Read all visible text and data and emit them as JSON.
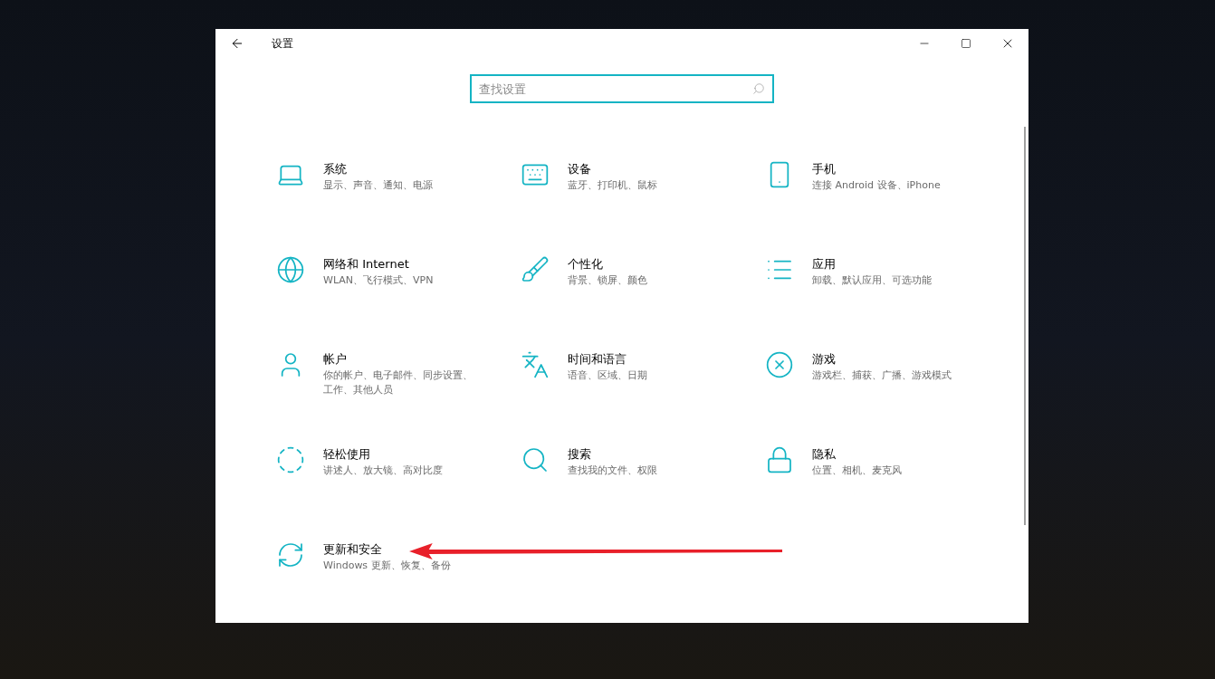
{
  "window": {
    "title": "设置"
  },
  "search": {
    "placeholder": "查找设置"
  },
  "categories": [
    {
      "kind": "system",
      "title": "系统",
      "description": "显示、声音、通知、电源"
    },
    {
      "kind": "devices",
      "title": "设备",
      "description": "蓝牙、打印机、鼠标"
    },
    {
      "kind": "phone",
      "title": "手机",
      "description": "连接 Android 设备、iPhone"
    },
    {
      "kind": "network",
      "title": "网络和 Internet",
      "description": "WLAN、飞行模式、VPN"
    },
    {
      "kind": "personalization",
      "title": "个性化",
      "description": "背景、锁屏、颜色"
    },
    {
      "kind": "apps",
      "title": "应用",
      "description": "卸载、默认应用、可选功能"
    },
    {
      "kind": "accounts",
      "title": "帐户",
      "description": "你的帐户、电子邮件、同步设置、工作、其他人员"
    },
    {
      "kind": "time",
      "title": "时间和语言",
      "description": "语音、区域、日期"
    },
    {
      "kind": "gaming",
      "title": "游戏",
      "description": "游戏栏、捕获、广播、游戏模式"
    },
    {
      "kind": "ease",
      "title": "轻松使用",
      "description": "讲述人、放大镜、高对比度"
    },
    {
      "kind": "search",
      "title": "搜索",
      "description": "查找我的文件、权限"
    },
    {
      "kind": "privacy",
      "title": "隐私",
      "description": "位置、相机、麦克风"
    },
    {
      "kind": "update",
      "title": "更新和安全",
      "description": "Windows 更新、恢复、备份"
    }
  ]
}
